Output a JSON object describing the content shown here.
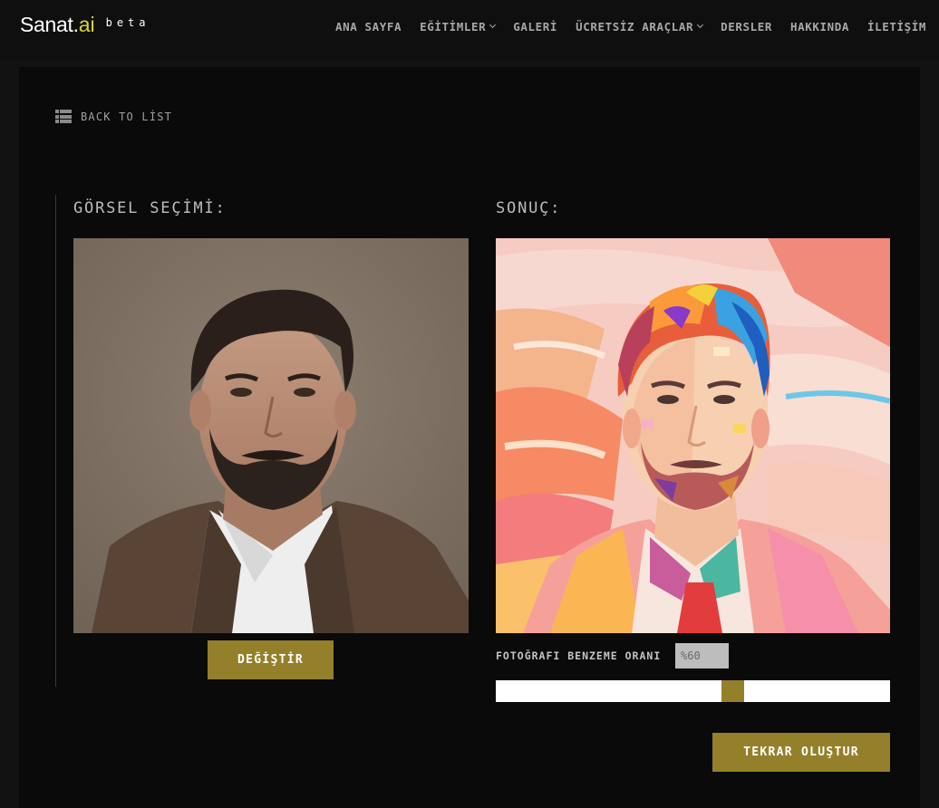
{
  "header": {
    "logo_text": "Sanat.",
    "logo_suffix": "ai",
    "logo_badge": "beta",
    "nav": [
      {
        "label": "ANA SAYFA",
        "dropdown": false
      },
      {
        "label": "EĞİTİMLER",
        "dropdown": true
      },
      {
        "label": "GALERİ",
        "dropdown": false
      },
      {
        "label": "ÜCRETSİZ ARAÇLAR",
        "dropdown": true
      },
      {
        "label": "DERSLER",
        "dropdown": false
      },
      {
        "label": "HAKKINDA",
        "dropdown": false
      },
      {
        "label": "İLETİŞİM",
        "dropdown": false
      }
    ]
  },
  "back_link": {
    "label": "BACK TO LİST",
    "icon": "list-icon"
  },
  "left": {
    "title": "GÖRSEL SEÇİMİ:",
    "image_alt": "portrait-photo",
    "change_button": "DEĞİŞTİR"
  },
  "right": {
    "title": "SONUÇ:",
    "image_alt": "painted-portrait",
    "similarity_label": "FOTOĞRAFI BENZEME ORANI",
    "similarity_value": "%60",
    "slider_value": 0.6,
    "regen_button": "TEKRAR OLUŞTUR"
  },
  "colors": {
    "accent": "#94802a",
    "logo_accent": "#d6d62a",
    "background": "#0a0a0a",
    "header": "#0f0f0f"
  }
}
